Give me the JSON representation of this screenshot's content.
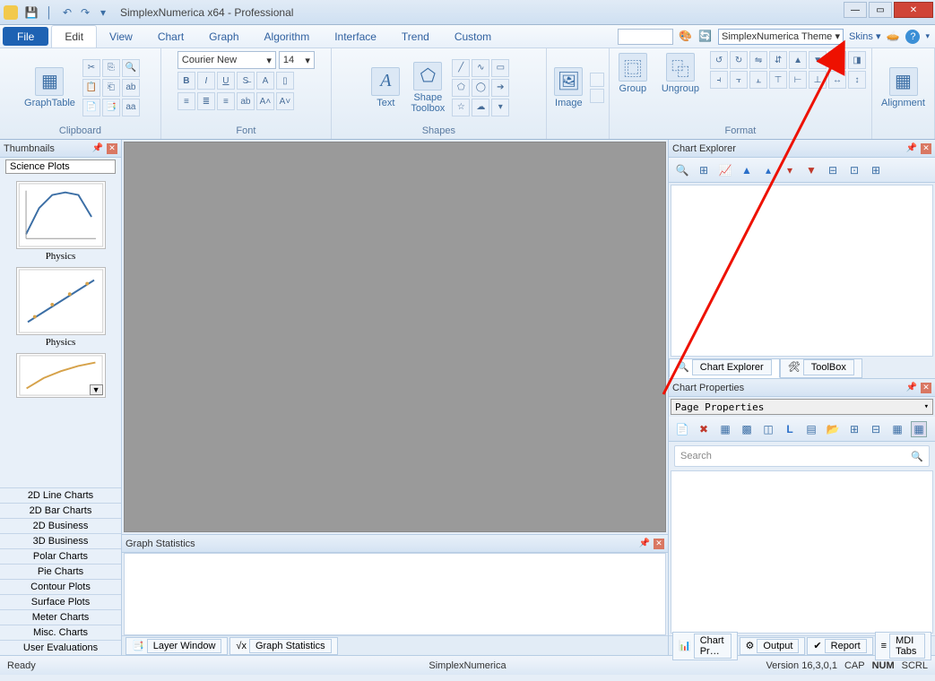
{
  "window": {
    "title": "SimplexNumerica x64 - Professional"
  },
  "tabs": {
    "file": "File",
    "edit": "Edit",
    "view": "View",
    "chart": "Chart",
    "graph": "Graph",
    "algorithm": "Algorithm",
    "interface": "Interface",
    "trend": "Trend",
    "custom": "Custom"
  },
  "topright": {
    "theme": "SimplexNumerica Theme",
    "skins": "Skins"
  },
  "ribbon": {
    "graphtable": "GraphTable",
    "clipboard": "Clipboard",
    "font_name": "Courier New",
    "font_size": "14",
    "font": "Font",
    "text": "Text",
    "shape_toolbox": "Shape\nToolbox",
    "shapes": "Shapes",
    "image": "Image",
    "group": "Group",
    "ungroup": "Ungroup",
    "format": "Format",
    "alignment": "Alignment"
  },
  "thumbs": {
    "title": "Thumbnails",
    "current_cat": "Science Plots",
    "items": [
      {
        "cap": "Physics"
      },
      {
        "cap": "Physics"
      }
    ],
    "cats": [
      "2D Line Charts",
      "2D Bar Charts",
      "2D Business",
      "3D Business",
      "Polar Charts",
      "Pie Charts",
      "Contour Plots",
      "Surface Plots",
      "Meter Charts",
      "Misc. Charts",
      "User Evaluations"
    ]
  },
  "gstats": {
    "title": "Graph Statistics"
  },
  "bottabs": {
    "layer": "Layer Window",
    "gstats": "Graph Statistics"
  },
  "ce": {
    "title": "Chart Explorer",
    "tab1": "Chart Explorer",
    "tab2": "ToolBox"
  },
  "cp": {
    "title": "Chart Properties",
    "combo": "Page Properties",
    "search": "Search"
  },
  "rtabs": {
    "chartpr": "Chart Pr…",
    "output": "Output",
    "report": "Report",
    "mdi": "MDI Tabs"
  },
  "status": {
    "ready": "Ready",
    "app": "SimplexNumerica",
    "ver": "Version 16,3,0,1",
    "cap": "CAP",
    "num": "NUM",
    "scrl": "SCRL"
  }
}
